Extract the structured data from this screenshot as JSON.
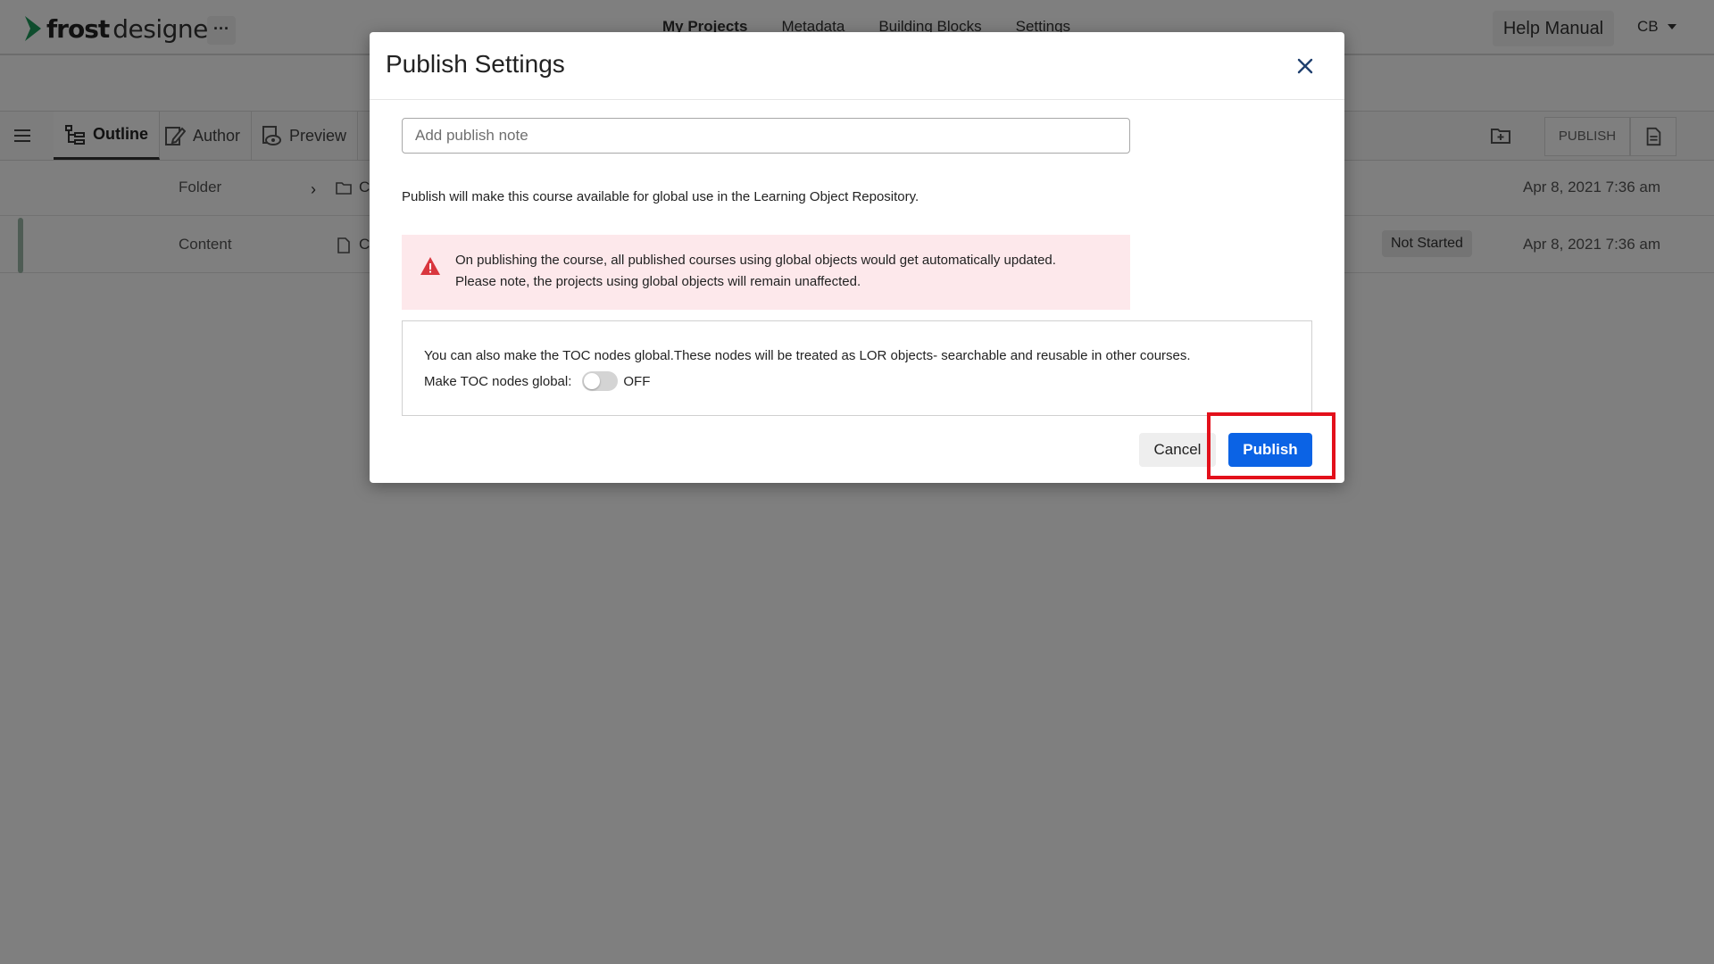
{
  "app": {
    "logo_bold": "frost",
    "logo_light": "designer",
    "more_label": "···",
    "nav": [
      "My Projects",
      "Metadata",
      "Building Blocks",
      "Settings"
    ],
    "help_label": "Help Manual",
    "user_initials": "CB"
  },
  "toolbar": {
    "tabs": [
      "Outline",
      "Author",
      "Preview"
    ],
    "publish_label": "PUBLISH"
  },
  "rows": [
    {
      "type": "Folder",
      "name_fragment": "C",
      "status": "",
      "date": "Apr 8, 2021 7:36 am"
    },
    {
      "type": "Content",
      "name_fragment": "C",
      "status": "Not Started",
      "date": "Apr 8, 2021 7:36 am"
    }
  ],
  "modal": {
    "title": "Publish Settings",
    "note_placeholder": "Add publish note",
    "info": "Publish will make this course available for global use in the Learning Object Repository.",
    "alert_line1": "On publishing the course, all published courses using global objects would get automatically updated.",
    "alert_line2": "Please note, the projects using global objects will remain unaffected.",
    "toc_text": "You can also make the TOC nodes global.These nodes will be treated as LOR objects- searchable and reusable in other courses.",
    "toc_label": "Make TOC nodes global:",
    "toggle_state": "OFF",
    "cancel_label": "Cancel",
    "publish_label": "Publish"
  },
  "colors": {
    "primary": "#0b63e5",
    "alert_bg": "#fde8eb",
    "alert_icon": "#d9363e",
    "highlight": "#e3101b",
    "logo_mark": "#1d9a5b"
  }
}
